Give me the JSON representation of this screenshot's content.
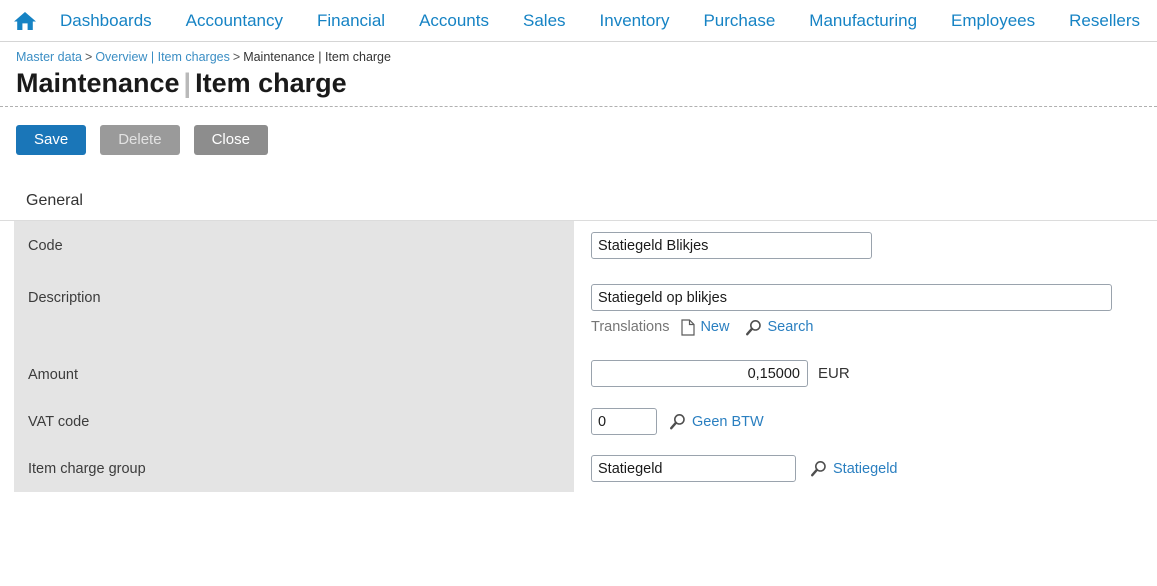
{
  "topnav": {
    "home_icon": "home-icon",
    "items": [
      {
        "label": "Dashboards"
      },
      {
        "label": "Accountancy"
      },
      {
        "label": "Financial"
      },
      {
        "label": "Accounts"
      },
      {
        "label": "Sales"
      },
      {
        "label": "Inventory"
      },
      {
        "label": "Purchase"
      },
      {
        "label": "Manufacturing"
      },
      {
        "label": "Employees"
      },
      {
        "label": "Resellers"
      }
    ]
  },
  "breadcrumb": {
    "root": "Master data",
    "sep1": ">",
    "parent": "Overview | Item charges",
    "sep2": ">",
    "current": "Maintenance | Item charge"
  },
  "title": {
    "left": "Maintenance",
    "divider": "|",
    "right": "Item charge"
  },
  "toolbar": {
    "save_label": "Save",
    "delete_label": "Delete",
    "close_label": "Close"
  },
  "section": {
    "heading": "General"
  },
  "form": {
    "code": {
      "label": "Code",
      "value": "Statiegeld Blikjes",
      "placeholder": ""
    },
    "description": {
      "label": "Description",
      "value": "Statiegeld op blikjes",
      "placeholder": ""
    },
    "translations": {
      "label": "Translations",
      "new_label": "New",
      "new_icon": "new-document-icon",
      "search_label": "Search",
      "search_icon": "magnifier-icon"
    },
    "amount": {
      "label": "Amount",
      "value": "0,15000",
      "placeholder": "",
      "currency": "EUR"
    },
    "vat_code": {
      "label": "VAT code",
      "value": "0",
      "placeholder": "",
      "lookup_icon": "magnifier-icon",
      "lookup_text": "Geen BTW"
    },
    "item_charge_group": {
      "label": "Item charge group",
      "value": "Statiegeld",
      "placeholder": "",
      "lookup_icon": "magnifier-icon",
      "lookup_text": "Statiegeld"
    }
  },
  "colors": {
    "accent_blue": "#1683c4",
    "primary_button": "#1a76b8",
    "muted_button": "#8d8d8d",
    "panel_gray": "#e4e4e4",
    "link_blue": "#2a7fc0"
  }
}
